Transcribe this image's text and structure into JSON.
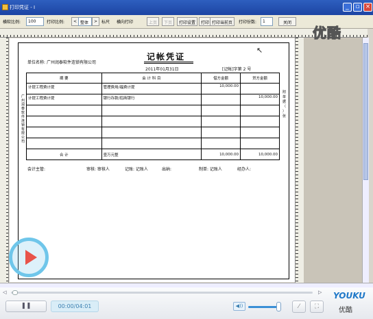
{
  "window": {
    "title": "打印凭证 - I"
  },
  "toolbar": {
    "scale_label": "横软比例:",
    "scale_value": "100",
    "print_scale_label": "打印比例:",
    "print_scale_value": "整体",
    "ruler_label": "标尺",
    "landscape_label": "横向打印",
    "prev_label": "上页",
    "next_label": "下页",
    "print_settings_label": "打印设置",
    "print_label": "打印",
    "print_current_label": "打印当前页",
    "copies_label": "打印份数:",
    "copies_value": "1",
    "close_label": "关闭"
  },
  "watermark": "优酷",
  "voucher": {
    "title": "记帐凭证",
    "company_label": "单位名称:",
    "company": "广州润泰软件连锁有限公司",
    "date": "2011年01月31日",
    "doc_no": "[记帐]字第 2 号",
    "headers": {
      "summary": "摘 要",
      "account": "会 计 科 目",
      "debit": "借方金额",
      "credit": "贷方金额"
    },
    "rows": [
      {
        "summary": "计提工程费计提",
        "account": "管理费用/福费计提",
        "debit": "10,000.00",
        "credit": ""
      },
      {
        "summary": "计提工程费计提",
        "account": "银行存款/招商银行",
        "debit": "",
        "credit": "10,000.00"
      },
      {
        "summary": "",
        "account": "",
        "debit": "",
        "credit": ""
      },
      {
        "summary": "",
        "account": "",
        "debit": "",
        "credit": ""
      },
      {
        "summary": "",
        "account": "",
        "debit": "",
        "credit": ""
      },
      {
        "summary": "",
        "account": "",
        "debit": "",
        "credit": ""
      }
    ],
    "total_label": "合 计",
    "total_words": "壹万元整",
    "total_debit": "10,000.00",
    "total_credit": "10,000.00",
    "left_side_text": "广州润泰软件连锁有限公司",
    "right_side_text": "附单据（ ）张",
    "signatures": {
      "supervisor": "会计主管:",
      "auditor": "审核: 审核人",
      "bookkeeper": "记账: 记账人",
      "cashier": "出纳:",
      "maker": "制单: 记账人",
      "handler": "经办人:"
    }
  },
  "player": {
    "time": "00:00/04:01",
    "pause_symbol": "❚❚",
    "logo_en": "YOUKU",
    "logo_cn": "优酷"
  },
  "colors": {
    "titlebar": "#2e5fbf",
    "play_ring": "#6fc6ea",
    "youku_blue": "#1f78c8",
    "youku_red": "#e5342c"
  }
}
